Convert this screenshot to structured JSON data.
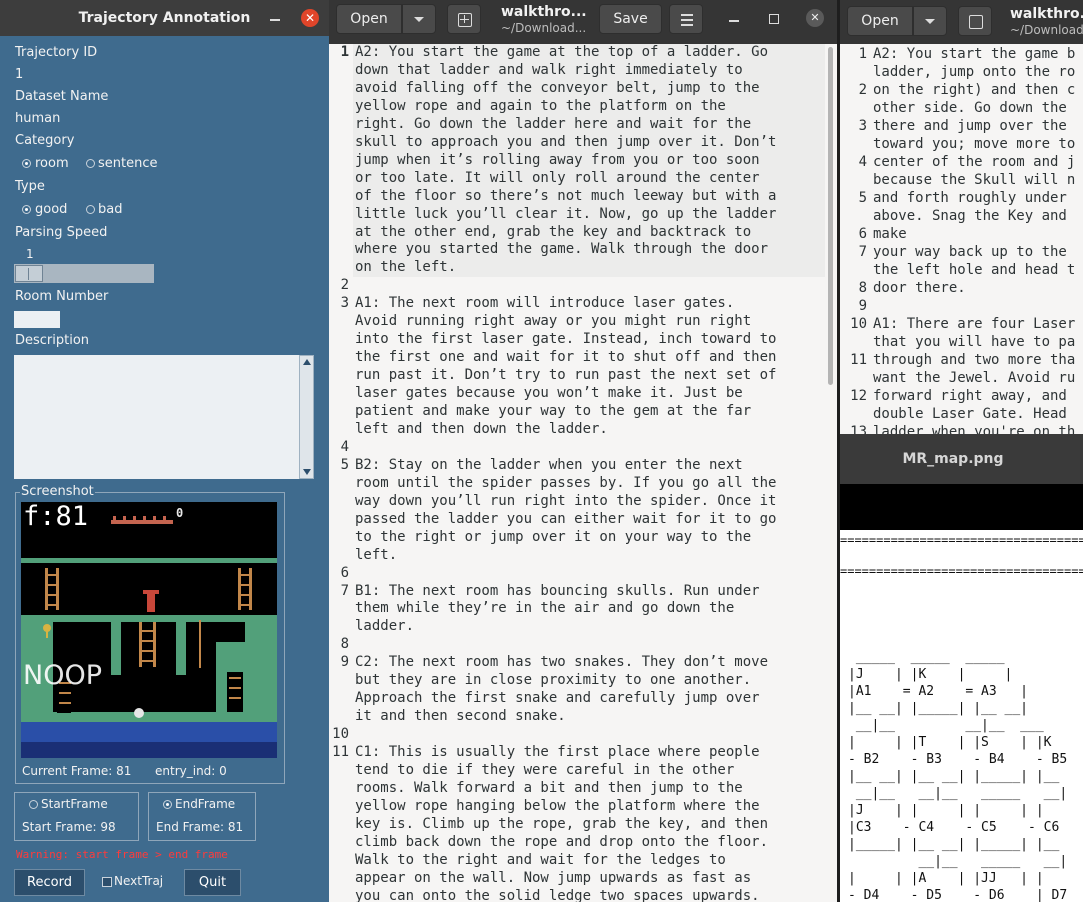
{
  "annotation": {
    "title": "Trajectory Annotation",
    "close_glyph": "✕",
    "trajectory_id_label": "Trajectory ID",
    "trajectory_id_value": "1",
    "dataset_name_label": "Dataset Name",
    "dataset_name_value": "human",
    "category_label": "Category",
    "category_options": [
      "room",
      "sentence"
    ],
    "category_selected": "room",
    "type_label": "Type",
    "type_options": [
      "good",
      "bad"
    ],
    "type_selected": "good",
    "parsing_speed_label": "Parsing Speed",
    "parsing_speed_value": "1",
    "room_number_label": "Room Number",
    "room_number_value": "",
    "description_label": "Description",
    "description_value": "",
    "screenshot_label": "Screenshot",
    "screenshot_frame_text": "f:81",
    "screenshot_score": "0",
    "screenshot_action": "NOOP",
    "current_frame_text": "Current Frame: 81",
    "entry_ind_text": "entry_ind: 0",
    "start_frame_radio": "StartFrame",
    "start_frame_text": "Start Frame: 98",
    "end_frame_radio": "EndFrame",
    "end_frame_text": "End Frame: 81",
    "frame_selected": "EndFrame",
    "warning": "Warning: start frame > end frame",
    "record_button": "Record",
    "next_traj_label": "NextTraj",
    "quit_button": "Quit",
    "colors": {
      "panel": "#3f6b8e",
      "warning": "#ff3b3b",
      "close": "#e0452a"
    }
  },
  "editor_main": {
    "open_button": "Open",
    "doc_name": "walkthro...",
    "doc_path": "~/Download...",
    "save_button": "Save",
    "lines": [
      {
        "n": "1",
        "rows": [
          "A2: You start the game at the top of a ladder. Go",
          "down that ladder and walk right immediately to",
          "avoid falling off the conveyor belt, jump to the",
          "yellow rope and again to the platform on the",
          "right. Go down the ladder here and wait for the",
          "skull to approach you and then jump over it. Don’t",
          "jump when it’s rolling away from you or too soon",
          "or too late. It will only roll around the center",
          "of the floor so there’s not much leeway but with a",
          "little luck you’ll clear it. Now, go up the ladder",
          "at the other end, grab the key and backtrack to",
          "where you started the game. Walk through the door",
          "on the left."
        ]
      },
      {
        "n": "2",
        "rows": [
          ""
        ]
      },
      {
        "n": "3",
        "rows": [
          "A1: The next room will introduce laser gates.",
          "Avoid running right away or you might run right",
          "into the first laser gate. Instead, inch toward to",
          "the first one and wait for it to shut off and then",
          "run past it. Don’t try to run past the next set of",
          "laser gates because you won’t make it. Just be",
          "patient and make your way to the gem at the far",
          "left and then down the ladder."
        ]
      },
      {
        "n": "4",
        "rows": [
          ""
        ]
      },
      {
        "n": "5",
        "rows": [
          "B2: Stay on the ladder when you enter the next",
          "room until the spider passes by. If you go all the",
          "way down you’ll run right into the spider. Once it",
          "passed the ladder you can either wait for it to go",
          "to the right or jump over it on your way to the",
          "left."
        ]
      },
      {
        "n": "6",
        "rows": [
          ""
        ]
      },
      {
        "n": "7",
        "rows": [
          "B1: The next room has bouncing skulls. Run under",
          "them while they’re in the air and go down the",
          "ladder."
        ]
      },
      {
        "n": "8",
        "rows": [
          ""
        ]
      },
      {
        "n": "9",
        "rows": [
          "C2: The next room has two snakes. They don’t move",
          "but they are in close proximity to one another.",
          "Approach the first snake and carefully jump over",
          "it and then second snake."
        ]
      },
      {
        "n": "10",
        "rows": [
          ""
        ]
      },
      {
        "n": "11",
        "rows": [
          "C1: This is usually the first place where people",
          "tend to die if they were careful in the other",
          "rooms. Walk forward a bit and then jump to the",
          "yellow rope hanging below the platform where the",
          "key is. Climb up the rope, grab the key, and then",
          "climb back down the rope and drop onto the floor.",
          "Walk to the right and wait for the ledges to",
          "appear on the wall. Now jump upwards as fast as",
          "you can onto the solid ledge two spaces upwards."
        ]
      }
    ]
  },
  "editor_side": {
    "open_button": "Open",
    "doc_name": "walkthro...",
    "doc_path": "~/Download...",
    "lines": [
      {
        "n": "1",
        "rows": [
          "A2: You start the game b",
          "ladder, jump onto the ro"
        ]
      },
      {
        "n": "2",
        "rows": [
          "on the right) and then c",
          "other side. Go down the"
        ]
      },
      {
        "n": "3",
        "rows": [
          "there and jump over the",
          "toward you; move more to"
        ]
      },
      {
        "n": "4",
        "rows": [
          "center of the room and j",
          "because the Skull will n"
        ]
      },
      {
        "n": "5",
        "rows": [
          "and forth roughly under",
          "above. Snag the Key and"
        ]
      },
      {
        "n": "6",
        "rows": [
          "make"
        ]
      },
      {
        "n": "7",
        "rows": [
          "your way back up to the",
          "the left hole and head t"
        ]
      },
      {
        "n": "8",
        "rows": [
          "door there."
        ]
      },
      {
        "n": "9",
        "rows": [
          ""
        ]
      },
      {
        "n": "10",
        "rows": [
          "A1: There are four Laser",
          "that you will have to pa"
        ]
      },
      {
        "n": "11",
        "rows": [
          "through and two more tha",
          "want the Jewel. Avoid ru"
        ]
      },
      {
        "n": "12",
        "rows": [
          "forward right away, and",
          "double Laser Gate. Head"
        ]
      },
      {
        "n": "13",
        "rows": [
          "ladder when you're on th"
        ]
      }
    ]
  },
  "image_viewer": {
    "title": "MR_map.png",
    "separator": "==========================================",
    "map_rows": [
      " _____  _____  _____",
      "|J    | |K    |     |",
      "|A1    = A2    = A3   |",
      "|__ __| |_____| |__ __|",
      " __|__         __|__  ___",
      "|     | |T    | |S    | |K",
      "- B2    - B3    - B4    - B5",
      "|__ __| |__ __| |_____| |__",
      " __|__   __|__   _____   __|",
      "|J    | |     | |     | |",
      "|C3    - C4    - C5    - C6",
      "|_____| |__ __| |_____| |__",
      "         __|__   _____   __|",
      "|     | |A    | |JJ   | |",
      "- D4    - D5    - D6    | D7"
    ]
  }
}
